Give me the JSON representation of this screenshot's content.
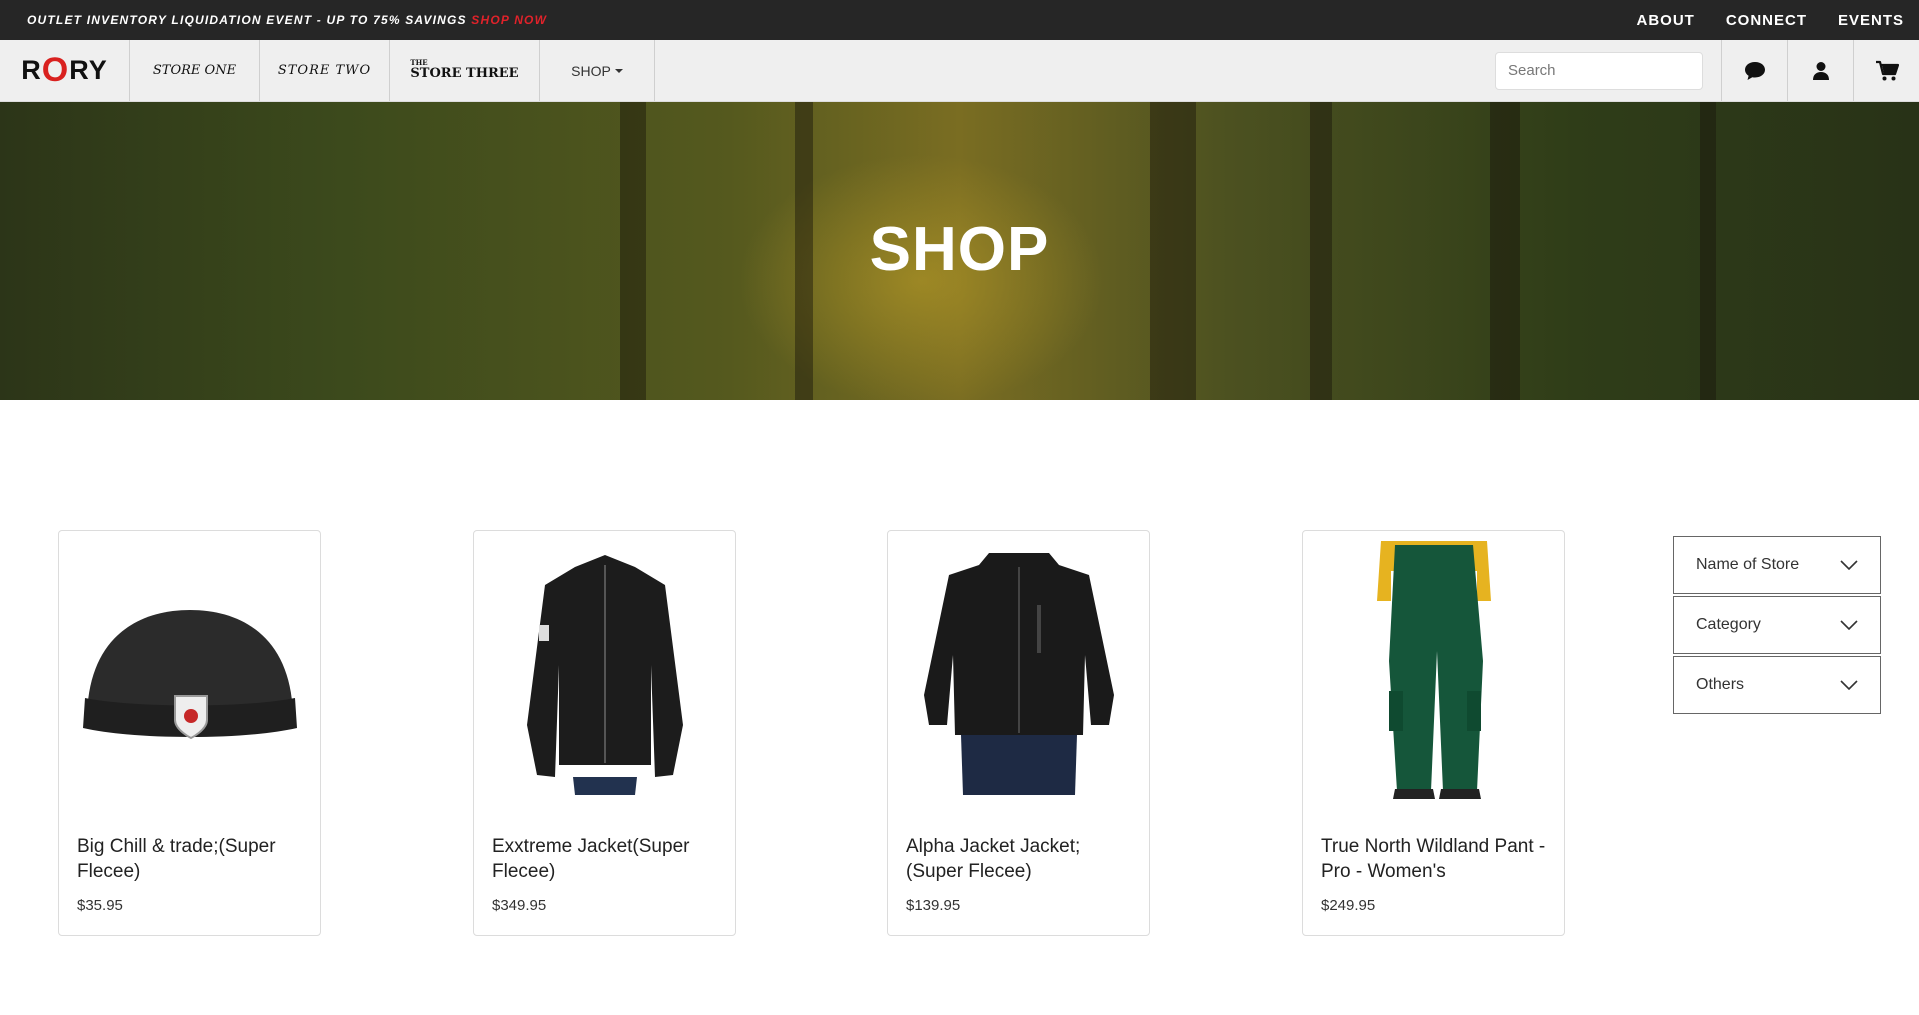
{
  "promo": {
    "text": "OUTLET INVENTORY LIQUIDATION EVENT - UP TO 75% SAVINGS",
    "cta": "SHOP NOW"
  },
  "top_links": [
    "ABOUT",
    "CONNECT",
    "EVENTS"
  ],
  "nav": {
    "logo": {
      "before": "R",
      "accent": "O",
      "after": "RY"
    },
    "store_one": "STORE ONE",
    "store_two": "STORE TWO",
    "store_three_prefix": "THE",
    "store_three": "STORE THREE",
    "shop": "SHOP",
    "search_placeholder": "Search"
  },
  "hero": {
    "title": "SHOP"
  },
  "products": [
    {
      "name": "Big Chill & trade;(Super Flecee)",
      "price": "$35.95",
      "icon": "beanie-image"
    },
    {
      "name": "Exxtreme Jacket(Super Flecee)",
      "price": "$349.95",
      "icon": "womens-jacket-image"
    },
    {
      "name": "Alpha Jacket Jacket;(Super Flecee)",
      "price": "$139.95",
      "icon": "mens-jacket-image"
    },
    {
      "name": "True North Wildland Pant - Pro - Women's",
      "price": "$249.95",
      "icon": "pants-image"
    }
  ],
  "filters": [
    "Name of Store",
    "Category",
    "Others"
  ],
  "colors": {
    "promo_bg": "#262626",
    "accent_red": "#e0222a",
    "nav_bg": "#efefef"
  }
}
